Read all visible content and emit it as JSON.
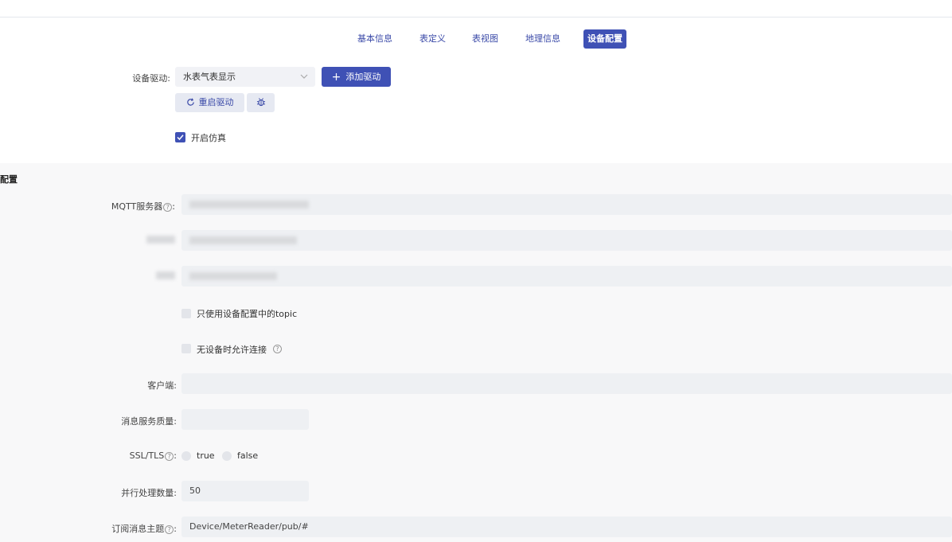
{
  "tabs": [
    "基本信息",
    "表定义",
    "表视图",
    "地理信息",
    "设备配置"
  ],
  "active_tab": "设备配置",
  "driver": {
    "label": "设备驱动:",
    "selected": "水表气表显示",
    "add_button": "添加驱动",
    "restart_button": "重启驱动",
    "simulate_label": "开启仿真",
    "simulate_checked": true
  },
  "config": {
    "section_title": "配置",
    "mqtt_label": "MQTT服务器",
    "colon": ":",
    "only_topic_label": "只使用设备配置中的topic",
    "allow_no_device_label": "无设备时允许连接",
    "client_label": "客户端:",
    "qos_label": "消息服务质量:",
    "ssl_label": "SSL/TLS",
    "ssl_true": "true",
    "ssl_false": "false",
    "parallel_label": "并行处理数量:",
    "parallel_value": "50",
    "topic_label": "订阅消息主题",
    "topic_value": "Device/MeterReader/pub/#"
  },
  "colors": {
    "accent": "#3f51b5",
    "accent_light": "#e6e9f2",
    "panel_bg": "#f8f8f9"
  },
  "icons": [
    "plus-icon",
    "refresh-icon",
    "bug-icon",
    "check-icon",
    "chevron-down-icon",
    "help-icon"
  ]
}
